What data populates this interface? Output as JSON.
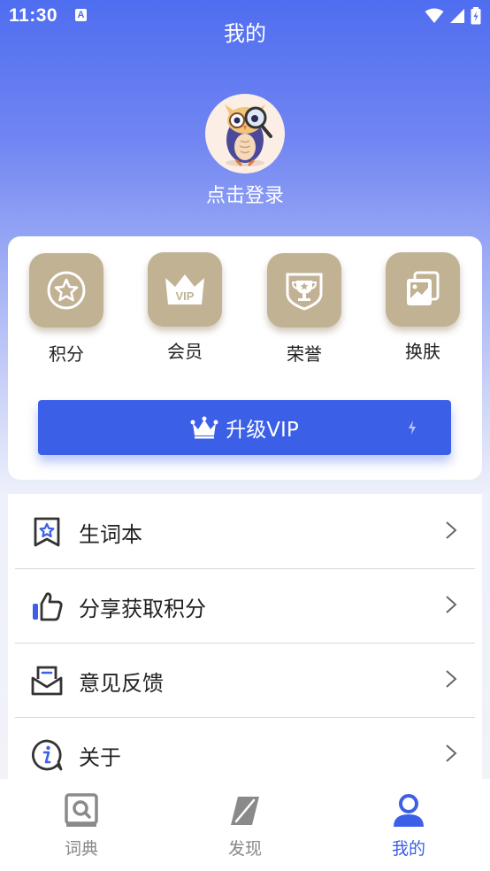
{
  "status_bar": {
    "time": "11:30",
    "notification_glyph": "A"
  },
  "header": {
    "title": "我的"
  },
  "profile": {
    "login_text": "点击登录",
    "avatar_icon": "owl-mascot-icon"
  },
  "features": [
    {
      "label": "积分",
      "icon": "points-star-icon"
    },
    {
      "label": "会员",
      "icon": "vip-crown-icon"
    },
    {
      "label": "荣誉",
      "icon": "trophy-badge-icon"
    },
    {
      "label": "换肤",
      "icon": "skin-photos-icon"
    }
  ],
  "vip_button": {
    "label": "升级VIP"
  },
  "menu": [
    {
      "label": "生词本",
      "icon": "bookmark-star-icon"
    },
    {
      "label": "分享获取积分",
      "icon": "thumbs-up-icon"
    },
    {
      "label": "意见反馈",
      "icon": "mail-feedback-icon"
    },
    {
      "label": "关于",
      "icon": "info-icon"
    }
  ],
  "bottom_nav": [
    {
      "label": "词典",
      "icon": "dictionary-icon",
      "active": false
    },
    {
      "label": "发现",
      "icon": "discover-leaf-icon",
      "active": false
    },
    {
      "label": "我的",
      "icon": "profile-person-icon",
      "active": true
    }
  ],
  "colors": {
    "accent": "#3c5fe8",
    "tile": "#c1b294",
    "header_top": "#4f6df0"
  }
}
